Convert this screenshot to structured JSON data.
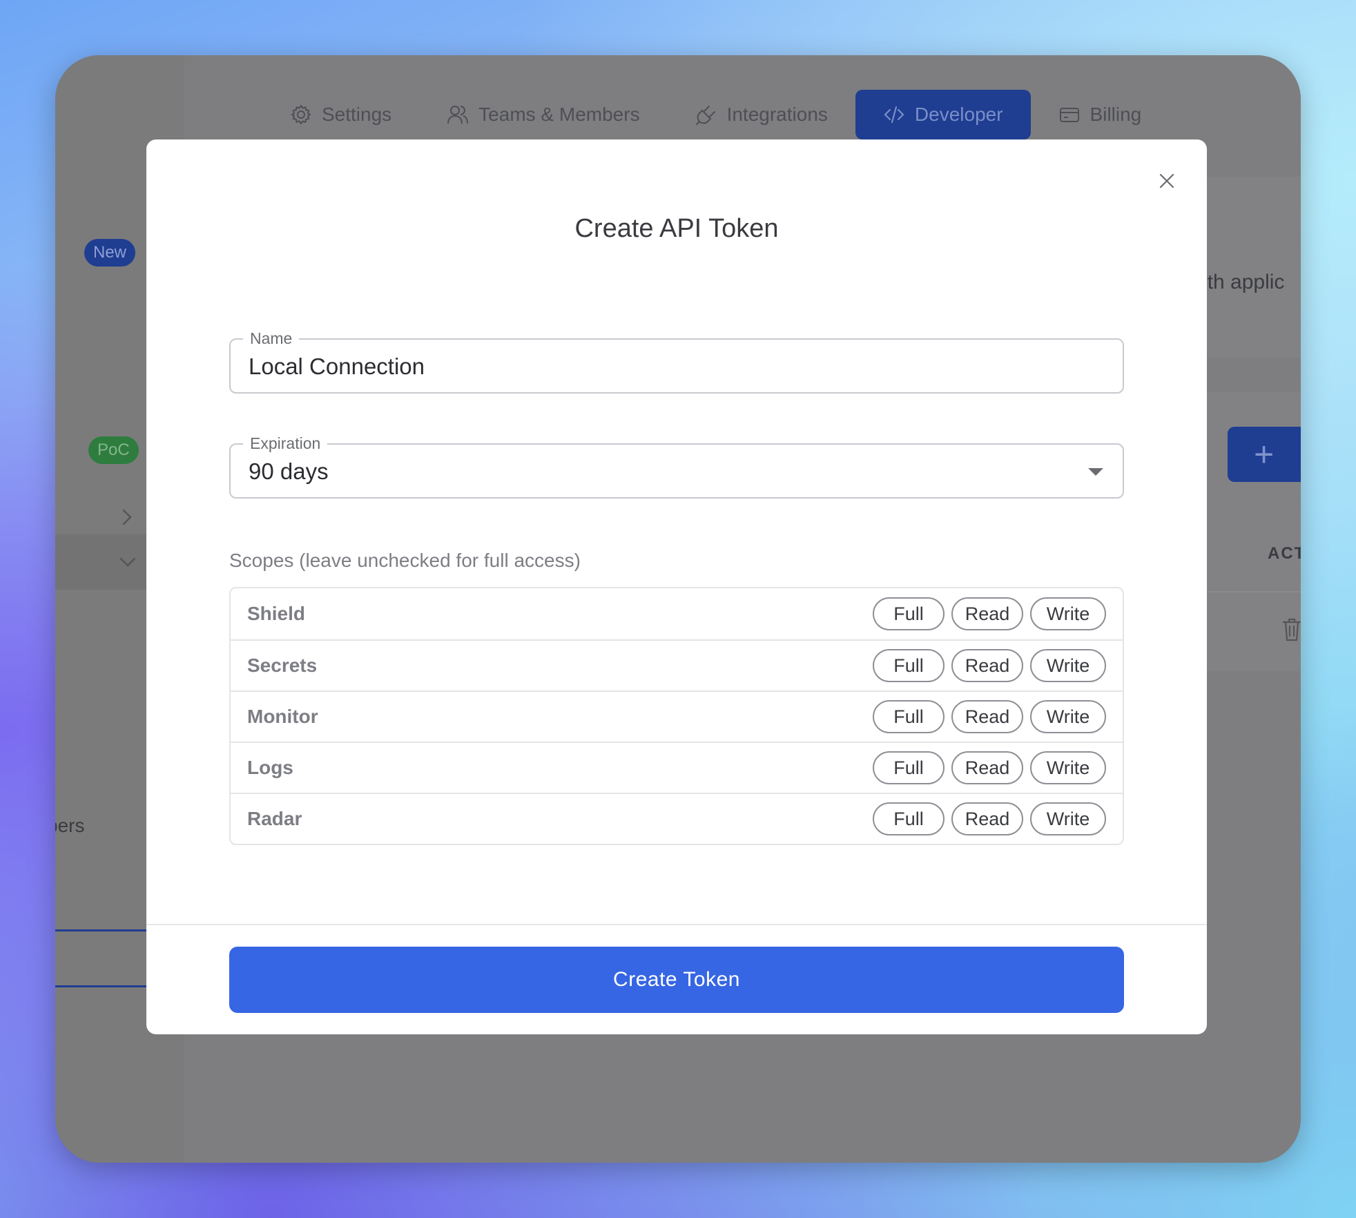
{
  "tabs": [
    {
      "label": "Settings",
      "icon": "gear-icon"
    },
    {
      "label": "Teams & Members",
      "icon": "users-icon"
    },
    {
      "label": "Integrations",
      "icon": "plug-icon"
    },
    {
      "label": "Developer",
      "icon": "code-icon",
      "active": true
    },
    {
      "label": "Billing",
      "icon": "credit-card-icon"
    }
  ],
  "sidebar": {
    "badge_new": "New",
    "badge_poc": "PoC",
    "partial_label": "bers"
  },
  "background": {
    "partial_oauth_text": "Auth applic",
    "table_header_actions": "ACT",
    "add_button_symbol": "+"
  },
  "modal": {
    "title": "Create API Token",
    "name_field": {
      "label": "Name",
      "value": "Local Connection"
    },
    "expiration_field": {
      "label": "Expiration",
      "value": "90 days"
    },
    "scopes_label": "Scopes (leave unchecked for full access)",
    "scope_options": {
      "full": "Full",
      "read": "Read",
      "write": "Write"
    },
    "scopes": [
      "Shield",
      "Secrets",
      "Monitor",
      "Logs",
      "Radar"
    ],
    "submit_label": "Create Token"
  },
  "colors": {
    "primary_button": "#3666e3",
    "active_tab": "#1f3d91",
    "badge_new": "#1f3d91",
    "badge_poc": "#2e7d3e"
  }
}
